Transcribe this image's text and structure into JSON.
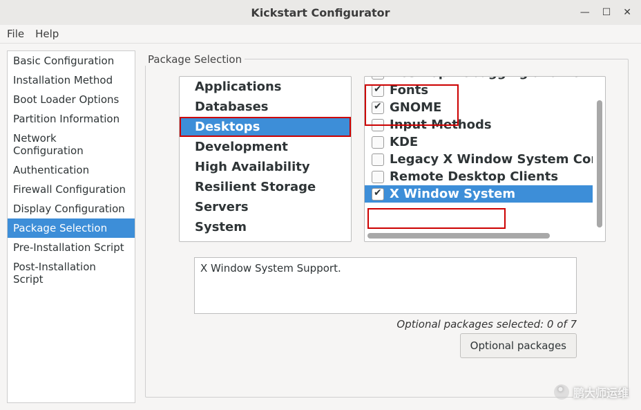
{
  "window": {
    "title": "Kickstart Configurator"
  },
  "menubar": {
    "file": "File",
    "help": "Help"
  },
  "sidebar": {
    "items": [
      {
        "label": "Basic Configuration",
        "selected": false
      },
      {
        "label": "Installation Method",
        "selected": false
      },
      {
        "label": "Boot Loader Options",
        "selected": false
      },
      {
        "label": "Partition Information",
        "selected": false
      },
      {
        "label": "Network Configuration",
        "selected": false
      },
      {
        "label": "Authentication",
        "selected": false
      },
      {
        "label": "Firewall Configuration",
        "selected": false
      },
      {
        "label": "Display Configuration",
        "selected": false
      },
      {
        "label": "Package Selection",
        "selected": true
      },
      {
        "label": "Pre-Installation Script",
        "selected": false
      },
      {
        "label": "Post-Installation Script",
        "selected": false
      }
    ]
  },
  "main": {
    "fieldset_label": "Package Selection",
    "categories": [
      {
        "label": "Applications",
        "selected": false,
        "highlighted": false
      },
      {
        "label": "Databases",
        "selected": false,
        "highlighted": false
      },
      {
        "label": "Desktops",
        "selected": true,
        "highlighted": true
      },
      {
        "label": "Development",
        "selected": false,
        "highlighted": false
      },
      {
        "label": "High Availability",
        "selected": false,
        "highlighted": false
      },
      {
        "label": "Resilient Storage",
        "selected": false,
        "highlighted": false
      },
      {
        "label": "Servers",
        "selected": false,
        "highlighted": false
      },
      {
        "label": "System",
        "selected": false,
        "highlighted": false
      }
    ],
    "packages": [
      {
        "label": "Desktop Debugging and Performance",
        "checked": false,
        "selected": false,
        "partial": true
      },
      {
        "label": "Fonts",
        "checked": true,
        "selected": false,
        "partial": false
      },
      {
        "label": "GNOME",
        "checked": true,
        "selected": false,
        "partial": false
      },
      {
        "label": "Input Methods",
        "checked": false,
        "selected": false,
        "partial": false
      },
      {
        "label": "KDE",
        "checked": false,
        "selected": false,
        "partial": false
      },
      {
        "label": "Legacy X Window System Compatibility",
        "checked": false,
        "selected": false,
        "partial": false
      },
      {
        "label": "Remote Desktop Clients",
        "checked": false,
        "selected": false,
        "partial": false
      },
      {
        "label": "X Window System",
        "checked": true,
        "selected": true,
        "partial": false
      }
    ],
    "description": "X Window System Support.",
    "optional_status": "Optional packages selected: 0 of 7",
    "optional_button": "Optional packages"
  },
  "watermark": "鹏大师运维"
}
